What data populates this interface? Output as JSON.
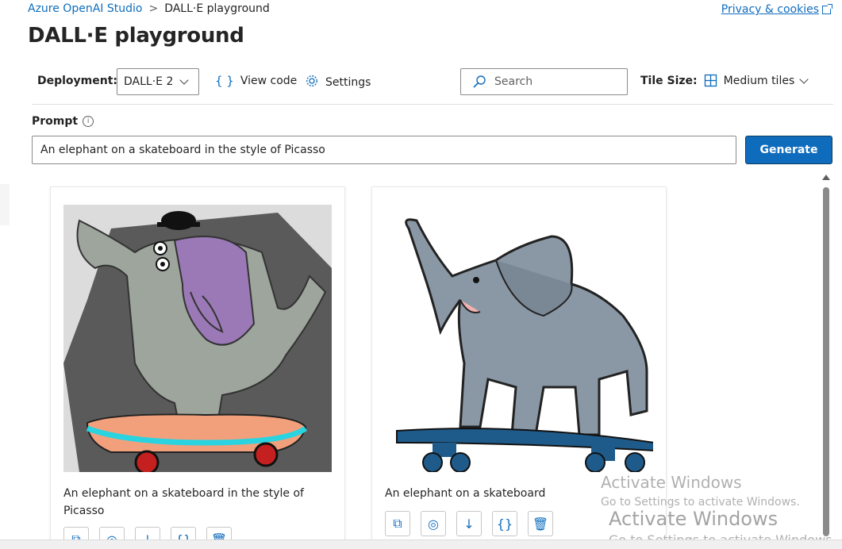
{
  "breadcrumb": {
    "root": "Azure OpenAI Studio",
    "separator": ">",
    "current": "DALL·E playground"
  },
  "privacy_link": "Privacy & cookies",
  "page_title": "DALL·E playground",
  "toolbar": {
    "deployment_label": "Deployment:",
    "deployment_value": "DALL·E 2",
    "view_code_label": "View code",
    "settings_label": "Settings",
    "search_placeholder": "Search",
    "tile_size_label": "Tile Size:",
    "tile_size_value": "Medium tiles"
  },
  "prompt": {
    "label": "Prompt",
    "info_glyph": "i",
    "value": "An elephant on a skateboard in the style of Picasso",
    "generate_label": "Generate"
  },
  "cards": [
    {
      "caption": "An elephant on a skateboard in the style of Picasso"
    },
    {
      "caption": "An elephant on a skateboard"
    }
  ],
  "watermarks": [
    {
      "title": "Activate Windows",
      "subtitle": "Go to Settings to activate Windows."
    },
    {
      "title": "Activate Windows",
      "subtitle": "Go to Settings to activate Windows."
    }
  ],
  "icons": {
    "view_code": "code-braces-icon",
    "settings": "gear-icon",
    "search": "search-icon",
    "tiles": "grid-icon",
    "card_actions": [
      "copy-icon",
      "variations-icon",
      "download-icon",
      "code-braces-icon",
      "delete-icon"
    ]
  },
  "colors": {
    "accent": "#0f6cbd",
    "text": "#242424"
  }
}
